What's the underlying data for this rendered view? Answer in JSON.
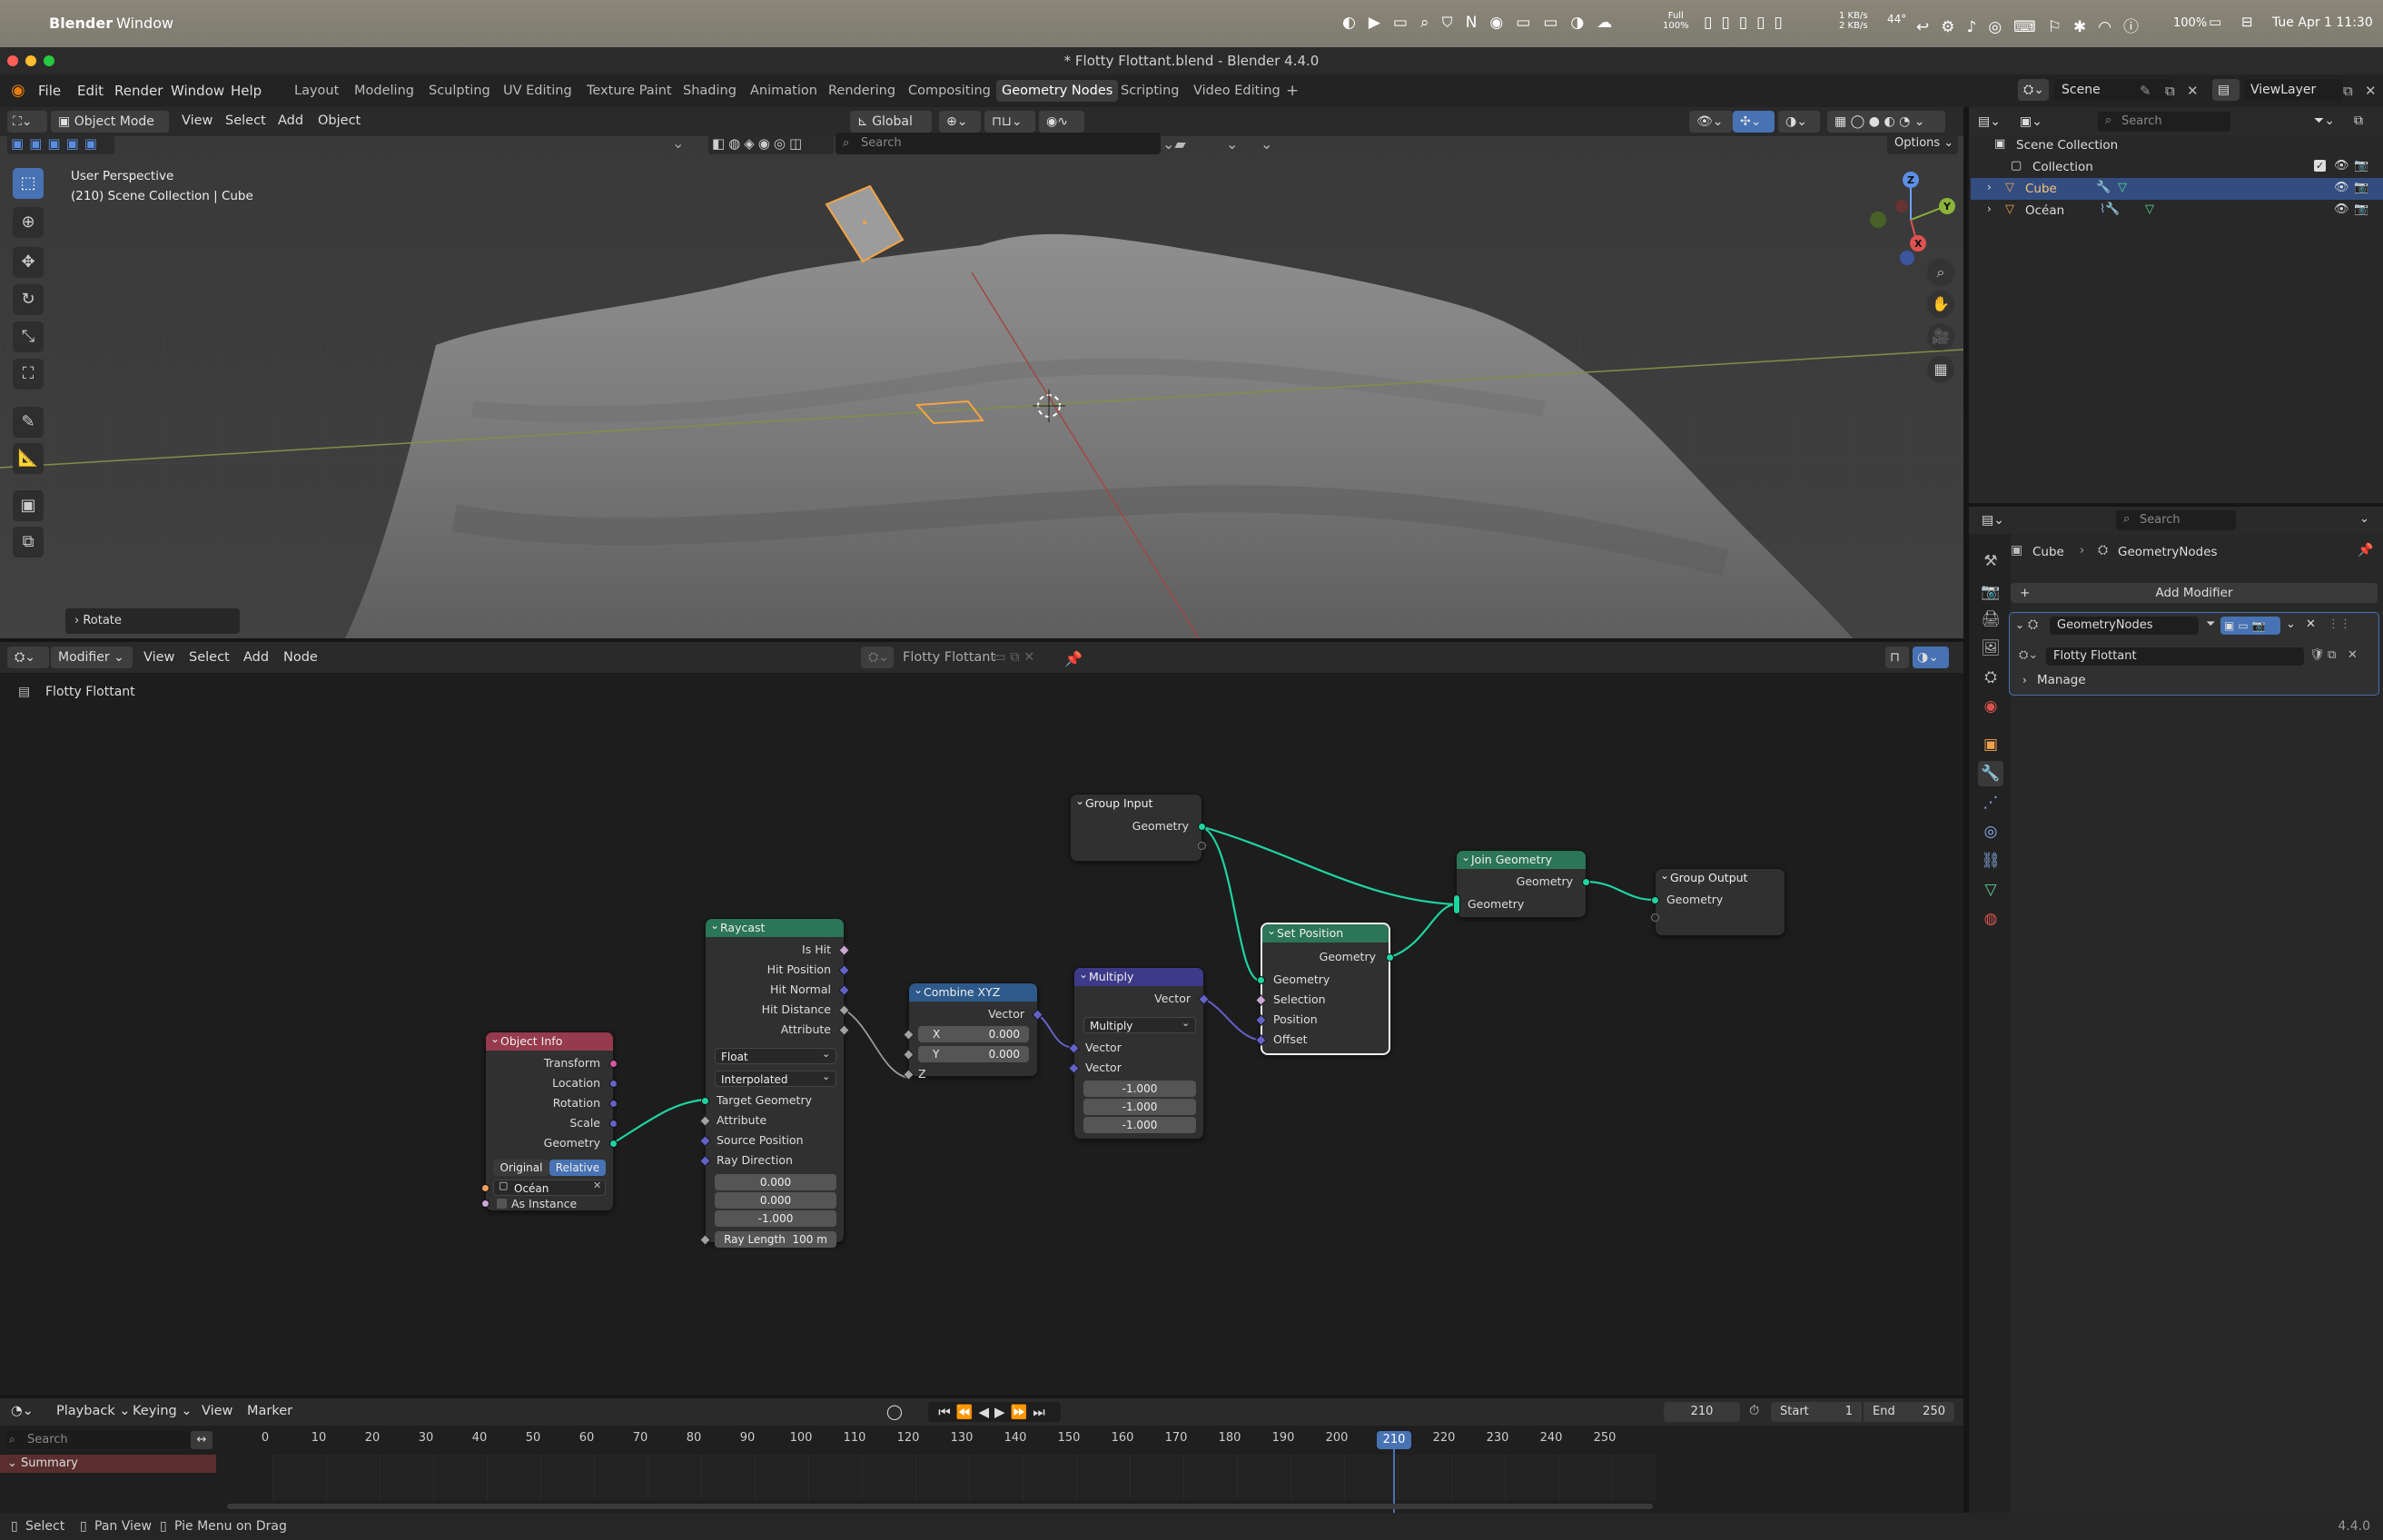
{
  "mac": {
    "app_name": "Blender",
    "menu_window": "Window",
    "battery": "100%",
    "net_up": "1 KB/s",
    "net_down": "2 KB/s",
    "temp": "44°",
    "full": "Full",
    "full_pct": "100%",
    "clock": "Tue Apr 1  11:30"
  },
  "window_title": "* Flotty Flottant.blend - Blender 4.4.0",
  "topbar": {
    "menus": [
      "File",
      "Edit",
      "Render",
      "Window",
      "Help"
    ],
    "workspaces": [
      "Layout",
      "Modeling",
      "Sculpting",
      "UV Editing",
      "Texture Paint",
      "Shading",
      "Animation",
      "Rendering",
      "Compositing",
      "Geometry Nodes",
      "Scripting",
      "Video Editing"
    ],
    "active_workspace": "Geometry Nodes",
    "add_workspace": "+",
    "scene": "Scene",
    "view_layer": "ViewLayer"
  },
  "viewport": {
    "mode": "Object Mode",
    "menus": [
      "View",
      "Select",
      "Add",
      "Object"
    ],
    "transform_orientation": "Global",
    "search_placeholder": "Search",
    "options": "Options",
    "perspective": "User Perspective",
    "info": "(210) Scene Collection | Cube",
    "last_op": "Rotate",
    "gizmo": {
      "x": "X",
      "y": "Y",
      "z": "Z"
    }
  },
  "node_editor": {
    "editor_type": "Modifier",
    "menus": [
      "View",
      "Select",
      "Add",
      "Node"
    ],
    "tree_name": "Flotty Flottant",
    "breadcrumb": "Flotty Flottant",
    "nodes": {
      "group_input": {
        "title": "Group Input",
        "geometry": "Geometry"
      },
      "object_info": {
        "title": "Object Info",
        "outputs": [
          "Transform",
          "Location",
          "Rotation",
          "Scale",
          "Geometry"
        ],
        "original": "Original",
        "relative": "Relative",
        "object": "Océan",
        "as_instance": "As Instance"
      },
      "raycast": {
        "title": "Raycast",
        "outputs": [
          "Is Hit",
          "Hit Position",
          "Hit Normal",
          "Hit Distance",
          "Attribute"
        ],
        "data_type": "Float",
        "mapping": "Interpolated",
        "inputs": [
          "Target Geometry",
          "Attribute",
          "Source Position",
          "Ray Direction"
        ],
        "dir_values": [
          "0.000",
          "0.000",
          "-1.000"
        ],
        "ray_length_label": "Ray Length",
        "ray_length_value": "100 m"
      },
      "combine_xyz": {
        "title": "Combine XYZ",
        "output": "Vector",
        "x_label": "X",
        "x_value": "0.000",
        "y_label": "Y",
        "y_value": "0.000",
        "z_label": "Z"
      },
      "multiply": {
        "title": "Multiply",
        "output": "Vector",
        "operation": "Multiply",
        "in1": "Vector",
        "in2": "Vector",
        "values": [
          "-1.000",
          "-1.000",
          "-1.000"
        ]
      },
      "set_position": {
        "title": "Set Position",
        "output": "Geometry",
        "inputs": [
          "Geometry",
          "Selection",
          "Position",
          "Offset"
        ]
      },
      "join_geometry": {
        "title": "Join Geometry",
        "output": "Geometry",
        "input": "Geometry"
      },
      "group_output": {
        "title": "Group Output",
        "input": "Geometry"
      }
    }
  },
  "timeline": {
    "menus": [
      "Playback",
      "Keying",
      "View",
      "Marker"
    ],
    "current_frame": "210",
    "start_label": "Start",
    "start": "1",
    "end_label": "End",
    "end": "250",
    "search_placeholder": "Search",
    "summary": "Summary",
    "ticks": [
      "0",
      "10",
      "20",
      "30",
      "40",
      "50",
      "60",
      "70",
      "80",
      "90",
      "100",
      "110",
      "120",
      "130",
      "140",
      "150",
      "160",
      "170",
      "180",
      "190",
      "200",
      "210",
      "220",
      "230",
      "240",
      "250"
    ]
  },
  "outliner": {
    "search_placeholder": "Search",
    "scene_collection": "Scene Collection",
    "collection": "Collection",
    "items": [
      "Cube",
      "Océan"
    ]
  },
  "properties": {
    "search_placeholder": "Search",
    "breadcrumb_object": "Cube",
    "breadcrumb_modifier": "GeometryNodes",
    "add_modifier": "Add Modifier",
    "modifier_name": "GeometryNodes",
    "node_group": "Flotty Flottant",
    "manage": "Manage"
  },
  "status": {
    "select": "Select",
    "pan": "Pan View",
    "pie": "Pie Menu on Drag",
    "version": "4.4.0"
  },
  "colors": {
    "accent": "#4772b3",
    "geometry_socket": "#00d6a3",
    "vector_socket": "#6363c7",
    "float_socket": "#a1a1a1",
    "object_socket": "#ed9e5c",
    "selection_orange": "#f5a442"
  }
}
